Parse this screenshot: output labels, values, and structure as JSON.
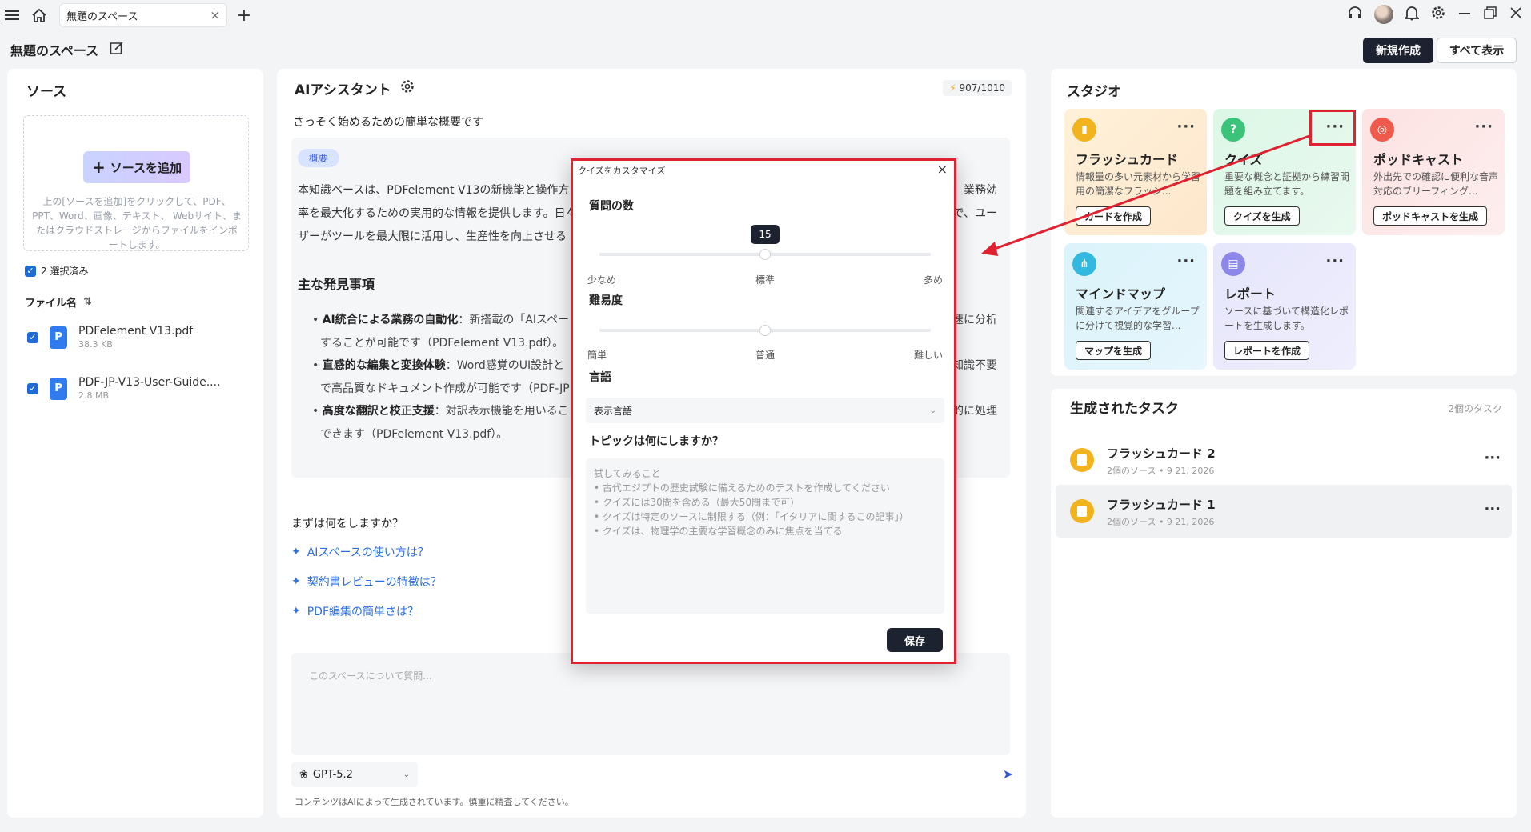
{
  "tab": {
    "title": "無題のスペース"
  },
  "header": {
    "space_title": "無題のスペース",
    "new_button": "新規作成",
    "show_all_button": "すべて表示"
  },
  "sources": {
    "title": "ソース",
    "add_button": "ソースを追加",
    "hint": "上の[ソースを追加]をクリックして、PDF、PPT、Word、画像、テキスト、 Webサイト、またはクラウドストレージからファイルをインポートします。",
    "selected": "2 選択済み",
    "file_header": "ファイル名",
    "files": [
      {
        "name": "PDFelement V13.pdf",
        "size": "38.3 KB"
      },
      {
        "name": "PDF-JP-V13-User-Guide....",
        "size": "2.8 MB"
      }
    ]
  },
  "assistant": {
    "title": "AIアシスタント",
    "credits": "907/1010",
    "intro": "さっそく始めるための簡単な概要です",
    "badge": "概要",
    "paragraph_a": "本知識ベースは、PDFelement V13の新機能と操作方",
    "paragraph_a2": "率を最大化するための実用的な情報を提供します。日々",
    "paragraph_a3": "ザーがツールを最大限に活用し、生産性を向上させる",
    "paragraph_right1": "で、業務効",
    "paragraph_right2": "まで、ユー",
    "heading": "主な発見事項",
    "b1_bold": "AI統合による業務の自動化",
    "b1_text": "：新搭載の「AIスペー",
    "b1_right": "迅速に分析",
    "b1_line2": "することが可能です（PDFelement V13.pdf）。",
    "b2_bold": "直感的な編集と変換体験",
    "b2_text": "：Word感覚のUI設計と",
    "b2_right": "知識不要",
    "b2_line2": "で高品質なドキュメント作成が可能です（PDF-JP",
    "b3_bold": "高度な翻訳と校正支援",
    "b3_text": "：対訳表示機能を用いるこ",
    "b3_right": "率的に処理",
    "b3_line2": "できます（PDFelement V13.pdf）。",
    "question": "まずは何をしますか？",
    "suggestions": [
      "AIスペースの使い方は？",
      "契約書レビューの特徴は？",
      "PDF編集の簡単さは？"
    ],
    "chat_placeholder": "このスペースについて質問...",
    "model": "GPT-5.2",
    "disclaimer": "コンテンツはAIによって生成されています。慎重に精査してください。"
  },
  "studio": {
    "title": "スタジオ",
    "cards": [
      {
        "title": "フラッシュカード",
        "desc": "情報量の多い元素材から学習用の簡潔なフラッシ...",
        "button": "カードを作成",
        "icon": "flashcard-icon"
      },
      {
        "title": "クイズ",
        "desc": "重要な概念と証拠から練習問題を組み立てます。",
        "button": "クイズを生成",
        "icon": "quiz-icon"
      },
      {
        "title": "ポッドキャスト",
        "desc": "外出先での確認に便利な音声対応のブリーフィング...",
        "button": "ポッドキャストを生成",
        "icon": "podcast-icon"
      },
      {
        "title": "マインドマップ",
        "desc": "関連するアイデアをグループに分けて視覚的な学習...",
        "button": "マップを生成",
        "icon": "mindmap-icon"
      },
      {
        "title": "レポート",
        "desc": "ソースに基づいて構造化レポートを生成します。",
        "button": "レポートを作成",
        "icon": "report-icon"
      }
    ]
  },
  "tasks": {
    "title": "生成されたタスク",
    "count": "2個のタスク",
    "items": [
      {
        "title": "フラッシュカード 2",
        "meta": "2個のソース • 9 21, 2026"
      },
      {
        "title": "フラッシュカード 1",
        "meta": "2個のソース • 9 21, 2026"
      }
    ]
  },
  "modal": {
    "header": "クイズをカスタマイズ",
    "q_count_label": "質問の数",
    "q_count_value": "15",
    "q_count_fraction": 0.5,
    "q_low": "少なめ",
    "q_mid": "標準",
    "q_high": "多め",
    "difficulty_label": "難易度",
    "difficulty_fraction": 0.5,
    "d_low": "簡単",
    "d_mid": "普通",
    "d_high": "難しい",
    "language_label": "言語",
    "language_value": "表示言語",
    "topic_label": "トピックは何にしますか？",
    "topic_ph": [
      "試してみること",
      "• 古代エジプトの歴史試験に備えるためのテストを作成してください",
      "• クイズには30問を含める（最大50問まで可）",
      "• クイズは特定のソースに制限する（例：「イタリアに関するこの記事」）",
      "• クイズは、物理学の主要な学習概念のみに焦点を当てる"
    ],
    "save": "保存"
  },
  "colors": {
    "accent": "#1d2230",
    "highlight": "#e02130",
    "link": "#2a6fe0"
  }
}
